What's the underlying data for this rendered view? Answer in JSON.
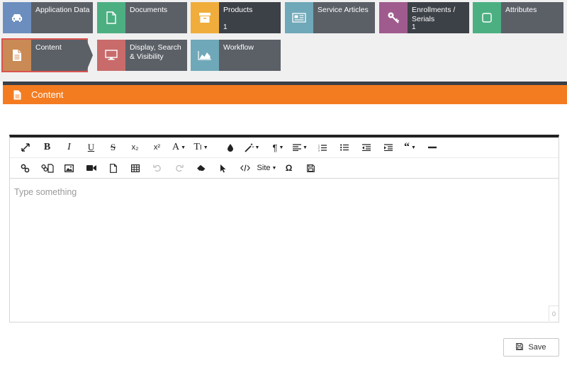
{
  "tiles": [
    {
      "label": "Application Data",
      "count": "",
      "color": "#6c8ebf",
      "icon": "car-icon"
    },
    {
      "label": "Documents",
      "count": "",
      "color": "#4caf82",
      "icon": "file-icon"
    },
    {
      "label": "Products",
      "count": "1",
      "color": "#f0ad3c",
      "icon": "box-icon"
    },
    {
      "label": "Service Articles",
      "count": "",
      "color": "#6fa8b8",
      "icon": "news-icon"
    },
    {
      "label": "Enrollments / Serials",
      "count": "1",
      "color": "#a05b8e",
      "icon": "key-icon"
    },
    {
      "label": "Attributes",
      "count": "",
      "color": "#4caf82",
      "icon": "square-icon"
    },
    {
      "label": "Content",
      "count": "",
      "color": "#c98a55",
      "icon": "document-icon"
    },
    {
      "label": "Display, Search & Visibility",
      "count": "",
      "color": "#c96b6b",
      "icon": "monitor-icon"
    },
    {
      "label": "Workflow",
      "count": "",
      "color": "#6fa8b8",
      "icon": "area-chart-icon"
    }
  ],
  "panel": {
    "title": "Content",
    "header_color": "#f47c20",
    "icon": "document-icon"
  },
  "editor": {
    "placeholder": "Type something",
    "char_count": "0",
    "site_label": "Site",
    "omega": "Ω",
    "subscript": "x₂",
    "superscript": "x²",
    "font_color": "A",
    "font_size": "T",
    "paragraph": "¶"
  },
  "actions": {
    "save_label": "Save"
  }
}
